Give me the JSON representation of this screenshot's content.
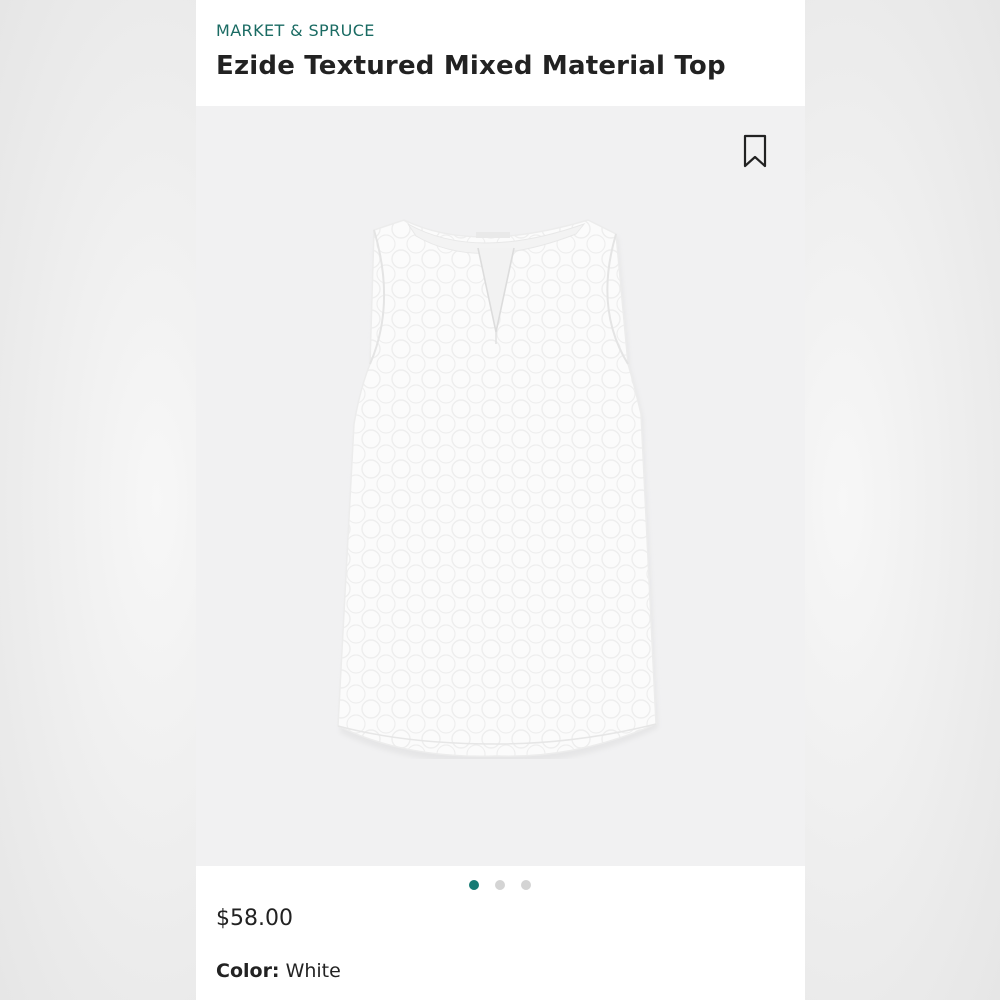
{
  "product": {
    "brand": "MARKET & SPRUCE",
    "title": "Ezide Textured Mixed Material Top",
    "price": "$58.00",
    "color_label": "Color:",
    "color_value": "White"
  },
  "gallery": {
    "image_count": 3,
    "active_index": 0
  },
  "icons": {
    "bookmark": "bookmark-icon"
  },
  "colors": {
    "brand_accent": "#1a6b63",
    "active_dot": "#167a74",
    "inactive_dot": "#d4d4d4",
    "image_background": "#f1f1f2"
  }
}
